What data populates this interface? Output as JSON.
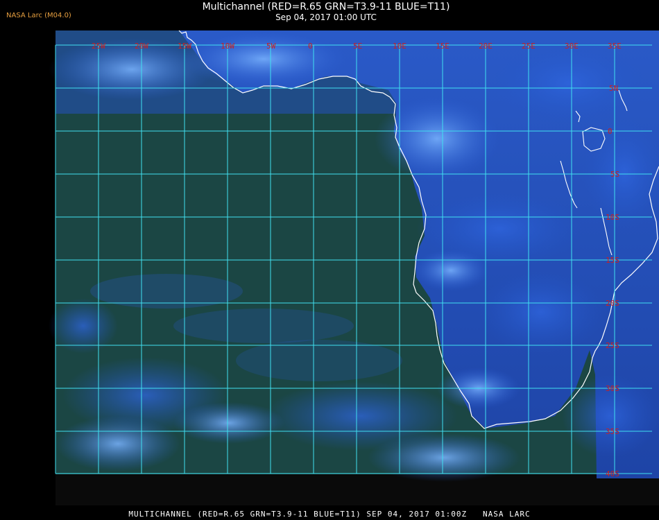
{
  "badge": "NASA Larc (M04.0)",
  "title": "Multichannel (RED=R.65 GRN=T3.9-11 BLUE=T11)",
  "subtitle": "Sep 04, 2017 01:00 UTC",
  "footer": "MULTICHANNEL (RED=R.65 GRN=T3.9-11 BLUE=T11) SEP 04, 2017 01:00Z   NASA LARC",
  "colors": {
    "grid": "#40e0f0",
    "coast": "#ffffff",
    "label": "#cc2020",
    "ocean": "#1c4a34",
    "cloud": "#2b5fd8",
    "cloud_bright": "#6aa8ff"
  },
  "grid": {
    "lon_labels": [
      "25W",
      "20W",
      "15W",
      "10W",
      "5W",
      "0",
      "5E",
      "10E",
      "15E",
      "20E",
      "25E",
      "30E",
      "35E"
    ],
    "lat_labels": [
      "5N",
      "0",
      "5S",
      "10S",
      "15S",
      "20S",
      "25S",
      "30S",
      "35S",
      "40S"
    ]
  }
}
